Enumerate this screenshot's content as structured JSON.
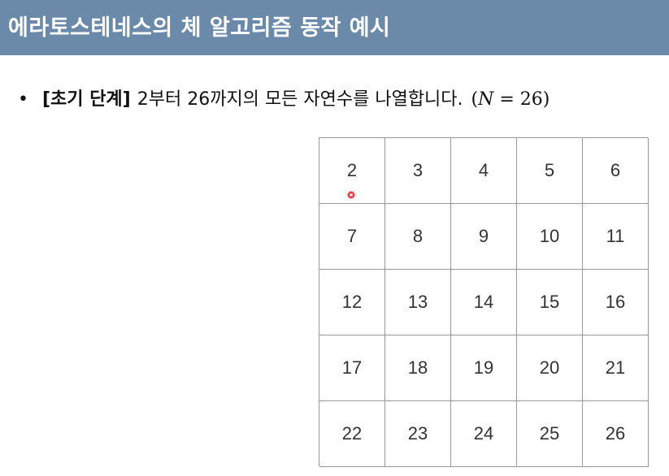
{
  "slide": {
    "title": "에라토스테네스의 체 알고리즘 동작 예시",
    "bullet": {
      "marker": "•",
      "bold": "[초기 단계]",
      "text": "2부터 26까지의 모든 자연수를 나열합니다.",
      "math_open": "(",
      "math_var": "N",
      "math_rest": " = 26)"
    },
    "grid_cells": [
      "2",
      "3",
      "4",
      "5",
      "6",
      "7",
      "8",
      "9",
      "10",
      "11",
      "12",
      "13",
      "14",
      "15",
      "16",
      "17",
      "18",
      "19",
      "20",
      "21",
      "22",
      "23",
      "24",
      "25",
      "26"
    ]
  },
  "colors": {
    "title_bar": "#6b8aa9",
    "grid_border": "#9a9a9a",
    "cursor": "#e02020"
  }
}
